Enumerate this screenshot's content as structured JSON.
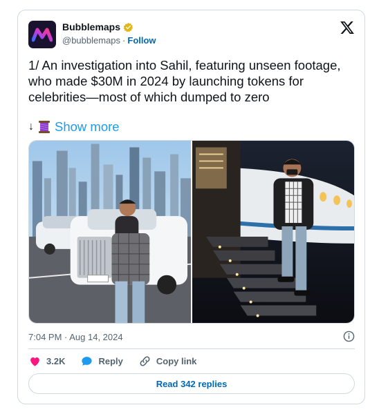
{
  "author": {
    "name": "Bubblemaps",
    "handle": "@bubblemaps",
    "separator": "·",
    "follow_label": "Follow"
  },
  "tweet": {
    "text": "1/ An investigation into Sahil, featuring unseen footage, who made $30M in 2024 by launching tokens for celebrities—most of which dumped to zero",
    "arrow": "↓",
    "show_more_label": "Show more",
    "timestamp": "7:04 PM · Aug 14, 2024"
  },
  "actions": {
    "likes_count": "3.2K",
    "reply_label": "Reply",
    "copy_link_label": "Copy link"
  },
  "footer": {
    "read_replies_label": "Read 342 replies"
  },
  "colors": {
    "link_blue": "#1d9bf0",
    "follow_blue": "#0069b4",
    "heart_pink": "#f91880",
    "verified_gold": "#e2b719",
    "muted_text": "#536471",
    "border": "#cfd9de"
  },
  "icons": [
    "bubblemaps-logo",
    "verified-badge-icon",
    "x-logo-icon",
    "thread-spool-icon",
    "info-icon",
    "heart-icon",
    "reply-bubble-icon",
    "link-icon"
  ]
}
